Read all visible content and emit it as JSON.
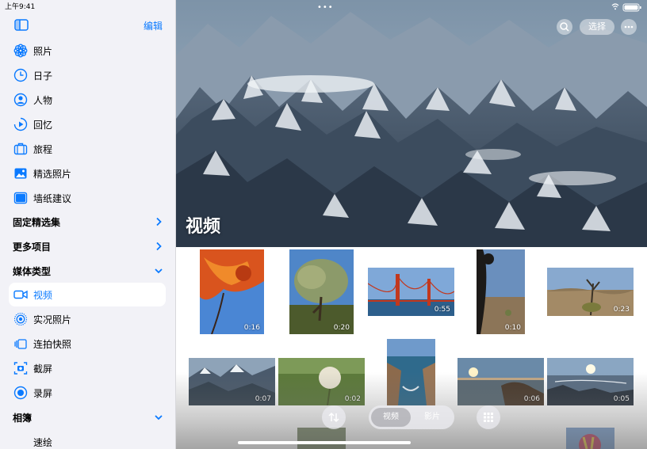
{
  "status": {
    "time": "上午9:41"
  },
  "sidebar": {
    "edit_label": "编辑",
    "items": [
      {
        "label": "照片",
        "icon": "flower-icon"
      },
      {
        "label": "日子",
        "icon": "clock-icon"
      },
      {
        "label": "人物",
        "icon": "person-circle-icon"
      },
      {
        "label": "回忆",
        "icon": "memories-play-icon"
      },
      {
        "label": "旅程",
        "icon": "suitcase-icon"
      },
      {
        "label": "精选照片",
        "icon": "photo-icon"
      },
      {
        "label": "墙纸建议",
        "icon": "wallpaper-icon"
      }
    ],
    "sections": {
      "pinned": "固定精选集",
      "more": "更多项目",
      "media_types": "媒体类型",
      "albums": "相簿"
    },
    "media_items": [
      {
        "label": "视频",
        "icon": "video-icon",
        "selected": true
      },
      {
        "label": "实况照片",
        "icon": "live-photo-icon",
        "selected": false
      },
      {
        "label": "连拍快照",
        "icon": "burst-icon",
        "selected": false
      },
      {
        "label": "截屏",
        "icon": "screenshot-icon",
        "selected": false
      },
      {
        "label": "录屏",
        "icon": "screen-record-icon",
        "selected": false
      }
    ],
    "album_items": [
      {
        "label": "速绘"
      }
    ],
    "accent": "#0a7aff"
  },
  "main": {
    "title": "视频",
    "select_label": "选择",
    "thumbnails": [
      {
        "duration": "0:16",
        "subject": "autumn-leaves"
      },
      {
        "duration": "0:20",
        "subject": "tree"
      },
      {
        "duration": "0:55",
        "subject": "golden-gate-bridge"
      },
      {
        "duration": "0:10",
        "subject": "joshua-tree"
      },
      {
        "duration": "0:23",
        "subject": "desert"
      },
      {
        "duration": "0:07",
        "subject": "mountains"
      },
      {
        "duration": "0:02",
        "subject": "dandelion"
      },
      {
        "duration": "",
        "subject": "sea-cliff"
      },
      {
        "duration": "0:06",
        "subject": "coast-sunset"
      },
      {
        "duration": "0:05",
        "subject": "rocky-shore"
      }
    ],
    "toolbar": {
      "segment_active": "视频",
      "segment_inactive": "影片"
    }
  }
}
